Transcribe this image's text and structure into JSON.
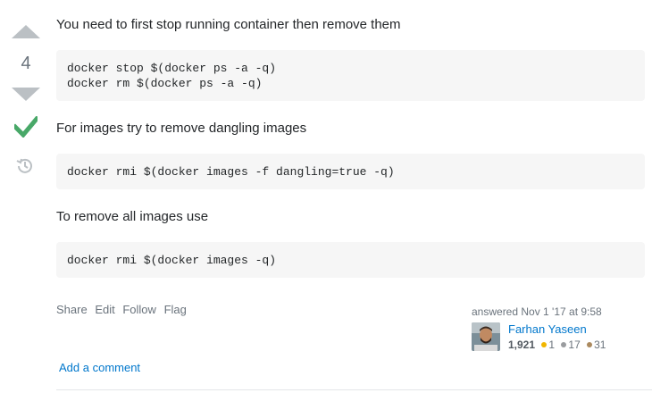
{
  "votes": {
    "count": "4"
  },
  "post": {
    "para1": "You need to first stop running container then remove them",
    "code1_line1": "docker stop $(docker ps -a -q)",
    "code1_line2": "docker rm $(docker ps -a -q)",
    "para2": "For images try to remove dangling images",
    "code2": "docker rmi $(docker images -f dangling=true -q)",
    "para3": "To remove all images use",
    "code3": "docker rmi $(docker images -q)"
  },
  "menu": {
    "share": "Share",
    "edit": "Edit",
    "follow": "Follow",
    "flag": "Flag"
  },
  "signature": {
    "action": "answered Nov 1 '17 at 9:58",
    "user_name": "Farhan Yaseen",
    "reputation": "1,921",
    "gold": "1",
    "silver": "17",
    "bronze": "31"
  },
  "colors": {
    "gold": "#f1b600",
    "silver": "#9a9c9f",
    "bronze": "#ab8a5f",
    "accepted": "#48a868",
    "link": "#0077cc"
  },
  "comments": {
    "add_label": "Add a comment"
  }
}
